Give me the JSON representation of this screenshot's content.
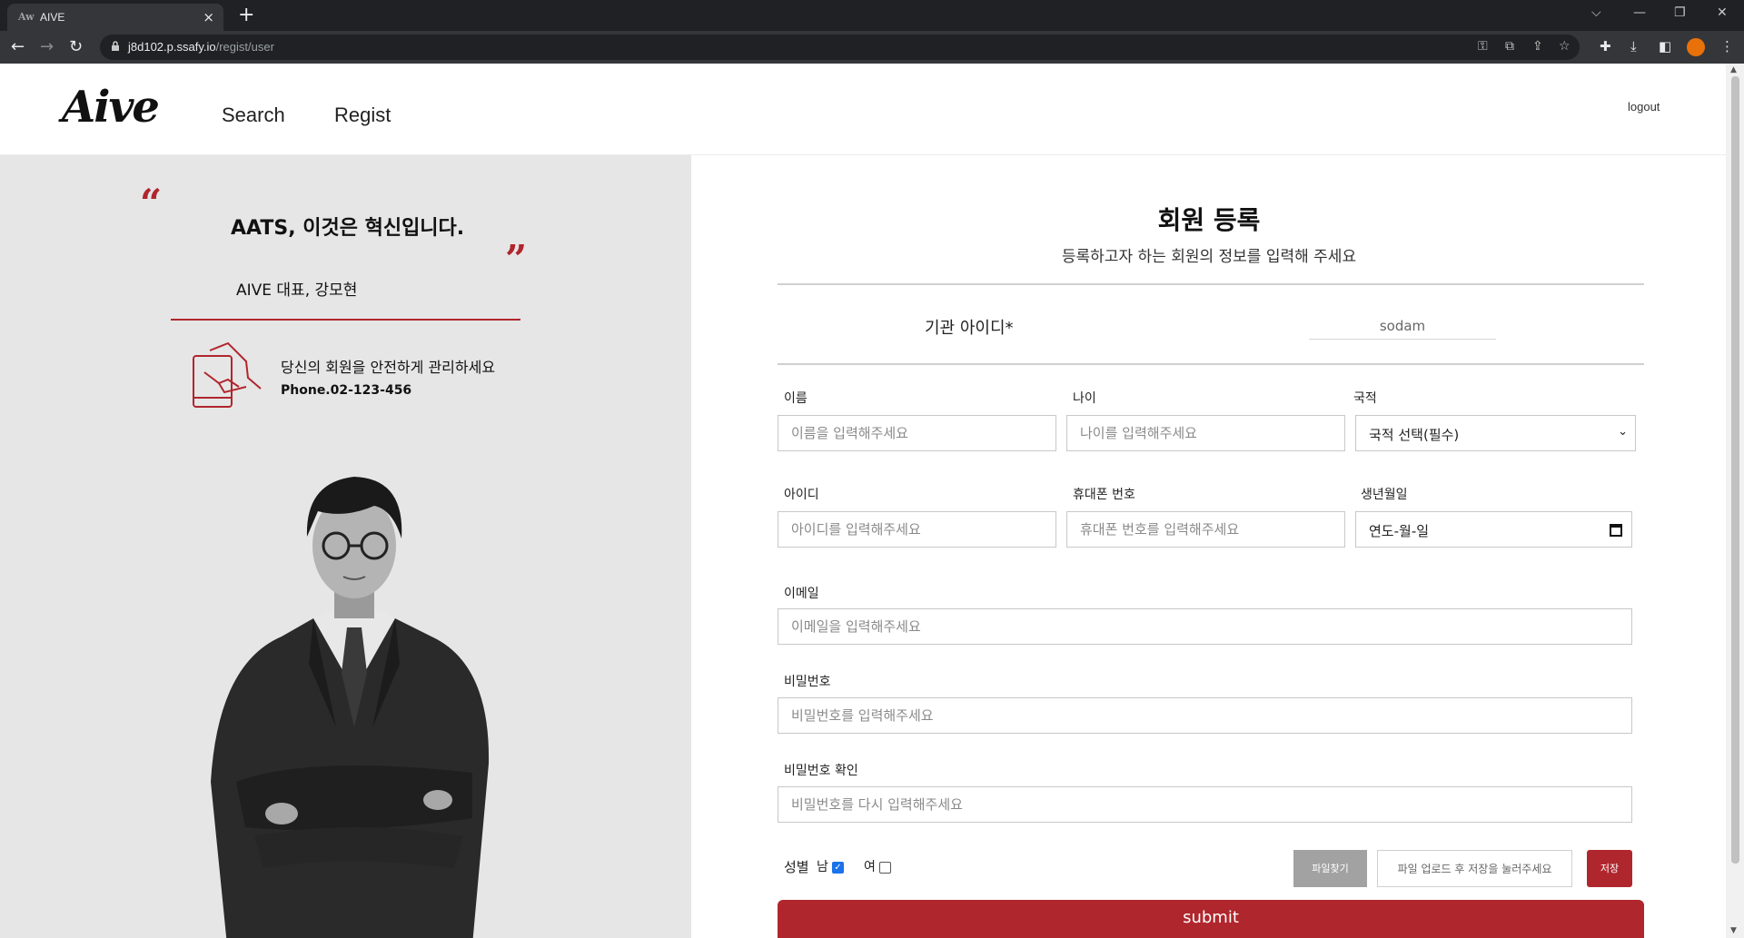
{
  "browser": {
    "tab_title": "AIVE",
    "favicon_text": "AIVE",
    "tab_close": "×",
    "new_tab": "+",
    "url_host": "j8d102.p.ssafy.io",
    "url_path": "/regist/user",
    "profile_color": "#e8710a"
  },
  "header": {
    "logo": "Aive",
    "nav": [
      "Search",
      "Regist"
    ],
    "logout": "logout"
  },
  "promo": {
    "slogan": "AATS, 이것은 혁신입니다.",
    "ceo": "AIVE 대표, 강모현",
    "manage_text": "당신의 회원을 안전하게 관리하세요",
    "phone": "Phone.02-123-456",
    "accent_color": "#b0262d"
  },
  "form": {
    "title": "회원 등록",
    "subtitle": "등록하고자 하는 회원의 정보를 입력해 주세요",
    "org_id_label": "기관 아이디*",
    "org_id_value": "sodam",
    "name": {
      "label": "이름",
      "placeholder": "이름을 입력해주세요"
    },
    "age": {
      "label": "나이",
      "placeholder": "나이를 입력해주세요"
    },
    "nationality": {
      "label": "국적",
      "value": "국적 선택(필수)"
    },
    "user_id": {
      "label": "아이디",
      "placeholder": "아이디를 입력해주세요"
    },
    "mobile": {
      "label": "휴대폰 번호",
      "placeholder": "휴대폰 번호를 입력해주세요"
    },
    "birth": {
      "label": "생년월일",
      "value": "연도-월-일"
    },
    "email": {
      "label": "이메일",
      "placeholder": "이메일을 입력해주세요"
    },
    "password": {
      "label": "비밀번호",
      "placeholder": "비밀번호를 입력해주세요"
    },
    "password_confirm": {
      "label": "비밀번호 확인",
      "placeholder": "비밀번호를 다시 입력해주세요"
    },
    "gender": {
      "label": "성별",
      "male": "남",
      "female": "여",
      "male_checked": true,
      "female_checked": false
    },
    "file_button": "파일찾기",
    "file_text": "파일 업로드 후 저장을 눌러주세요",
    "save_button": "저장",
    "submit": "submit"
  }
}
